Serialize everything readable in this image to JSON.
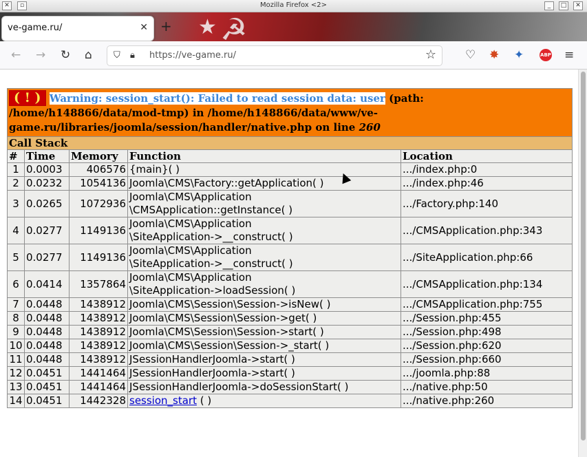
{
  "window": {
    "title": "Mozilla Firefox <2>"
  },
  "tab": {
    "label": "ve-game.ru/"
  },
  "urlbar": {
    "url": "https://ve-game.ru/"
  },
  "warning": {
    "badge": "( ! )",
    "message_highlighted": "Warning: session_start(): Failed to read session data: user",
    "message_rest": "(path: /home/h148866/data/mod-tmp) in /home/h148866/data/www/ve-game.ru/libraries/joomla/session/handler/native.php on line",
    "line": "260"
  },
  "callstack": {
    "title": "Call Stack",
    "headers": {
      "num": "#",
      "time": "Time",
      "memory": "Memory",
      "function": "Function",
      "location": "Location"
    },
    "rows": [
      {
        "num": "1",
        "time": "0.0003",
        "memory": "406576",
        "fn1": "{main}( )",
        "fn2": "",
        "location": ".../index.php:0"
      },
      {
        "num": "2",
        "time": "0.0232",
        "memory": "1054136",
        "fn1": "Joomla\\CMS\\Factory::getApplication( )",
        "fn2": "",
        "location": ".../index.php:46"
      },
      {
        "num": "3",
        "time": "0.0265",
        "memory": "1072936",
        "fn1": "Joomla\\CMS\\Application",
        "fn2": "\\CMSApplication::getInstance( )",
        "location": ".../Factory.php:140"
      },
      {
        "num": "4",
        "time": "0.0277",
        "memory": "1149136",
        "fn1": "Joomla\\CMS\\Application",
        "fn2": "\\SiteApplication->__construct( )",
        "location": ".../CMSApplication.php:343"
      },
      {
        "num": "5",
        "time": "0.0277",
        "memory": "1149136",
        "fn1": "Joomla\\CMS\\Application",
        "fn2": "\\SiteApplication->__construct( )",
        "location": ".../SiteApplication.php:66"
      },
      {
        "num": "6",
        "time": "0.0414",
        "memory": "1357864",
        "fn1": "Joomla\\CMS\\Application",
        "fn2": "\\SiteApplication->loadSession( )",
        "location": ".../CMSApplication.php:134"
      },
      {
        "num": "7",
        "time": "0.0448",
        "memory": "1438912",
        "fn1": "Joomla\\CMS\\Session\\Session->isNew( )",
        "fn2": "",
        "location": ".../CMSApplication.php:755"
      },
      {
        "num": "8",
        "time": "0.0448",
        "memory": "1438912",
        "fn1": "Joomla\\CMS\\Session\\Session->get( )",
        "fn2": "",
        "location": ".../Session.php:455"
      },
      {
        "num": "9",
        "time": "0.0448",
        "memory": "1438912",
        "fn1": "Joomla\\CMS\\Session\\Session->start( )",
        "fn2": "",
        "location": ".../Session.php:498"
      },
      {
        "num": "10",
        "time": "0.0448",
        "memory": "1438912",
        "fn1": "Joomla\\CMS\\Session\\Session->_start( )",
        "fn2": "",
        "location": ".../Session.php:620"
      },
      {
        "num": "11",
        "time": "0.0448",
        "memory": "1438912",
        "fn1": "JSessionHandlerJoomla->start( )",
        "fn2": "",
        "location": ".../Session.php:660"
      },
      {
        "num": "12",
        "time": "0.0451",
        "memory": "1441464",
        "fn1": "JSessionHandlerJoomla->start( )",
        "fn2": "",
        "location": ".../joomla.php:88"
      },
      {
        "num": "13",
        "time": "0.0451",
        "memory": "1441464",
        "fn1": "JSessionHandlerJoomla->doSessionStart( )",
        "fn2": "",
        "location": ".../native.php:50"
      },
      {
        "num": "14",
        "time": "0.0451",
        "memory": "1442328",
        "fn1": "session_start",
        "fn1_suffix": " ( )",
        "fn2": "",
        "location": ".../native.php:260",
        "link": true
      }
    ]
  }
}
